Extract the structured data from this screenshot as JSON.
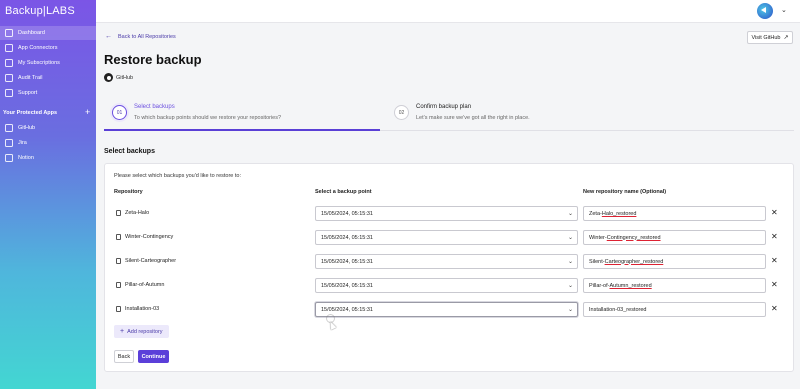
{
  "app": {
    "logo_text": "Backup",
    "logo_suffix": "LABS"
  },
  "sidebar": {
    "items": [
      {
        "label": "Dashboard",
        "icon": "grid-icon"
      },
      {
        "label": "App Connectors",
        "icon": "plug-icon"
      },
      {
        "label": "My Subscriptions",
        "icon": "card-icon"
      },
      {
        "label": "Audit Trail",
        "icon": "list-icon"
      },
      {
        "label": "Support",
        "icon": "help-icon"
      }
    ],
    "section_title": "Your Protected Apps",
    "apps": [
      {
        "label": "GitHub",
        "icon": "github-icon"
      },
      {
        "label": "Jira",
        "icon": "jira-icon"
      },
      {
        "label": "Notion",
        "icon": "notion-icon"
      }
    ]
  },
  "header": {
    "back_label": "Back to All Repositories",
    "visit_label": "Visit GitHub",
    "title": "Restore backup",
    "source": "GitHub"
  },
  "steps": [
    {
      "num": "01",
      "title": "Select backups",
      "desc": "To which backup points should we restore your repositories?",
      "active": true
    },
    {
      "num": "02",
      "title": "Confirm backup plan",
      "desc": "Let's make sure we've got all the right in place.",
      "active": false
    }
  ],
  "section_title": "Select backups",
  "card": {
    "prompt": "Please select which backups you'd like to restore to:",
    "columns": {
      "repo": "Repository",
      "point": "Select a backup point",
      "name": "New repository name (Optional)"
    },
    "rows": [
      {
        "repo": "Zeta-Halo",
        "point": "15/05/2024, 05:15:31",
        "name_prefix": "Zeta-",
        "name_ul": "Halo_restored"
      },
      {
        "repo": "Winter-Contingency",
        "point": "15/05/2024, 05:15:31",
        "name_prefix": "Winter-",
        "name_ul": "Contingency_restored"
      },
      {
        "repo": "Silent-Carteographer",
        "point": "15/05/2024, 05:15:31",
        "name_prefix": "Silent-",
        "name_ul": "Carteographer_restored"
      },
      {
        "repo": "Pillar-of-Autumn",
        "point": "15/05/2024, 05:15:31",
        "name_prefix": "Pillar-of-",
        "name_ul": "Autumn_restored"
      },
      {
        "repo": "Installation-03",
        "point": "15/05/2024, 05:15:31",
        "name_prefix": "Installation-03_restored",
        "name_ul": ""
      }
    ],
    "add_label": "Add repository",
    "back_button": "Back",
    "continue_button": "Continue"
  },
  "colors": {
    "accent": "#5b3fd9",
    "accent_light": "#ece9fb",
    "sidebar_top": "#7b55e6",
    "sidebar_bottom": "#43d6d2"
  }
}
